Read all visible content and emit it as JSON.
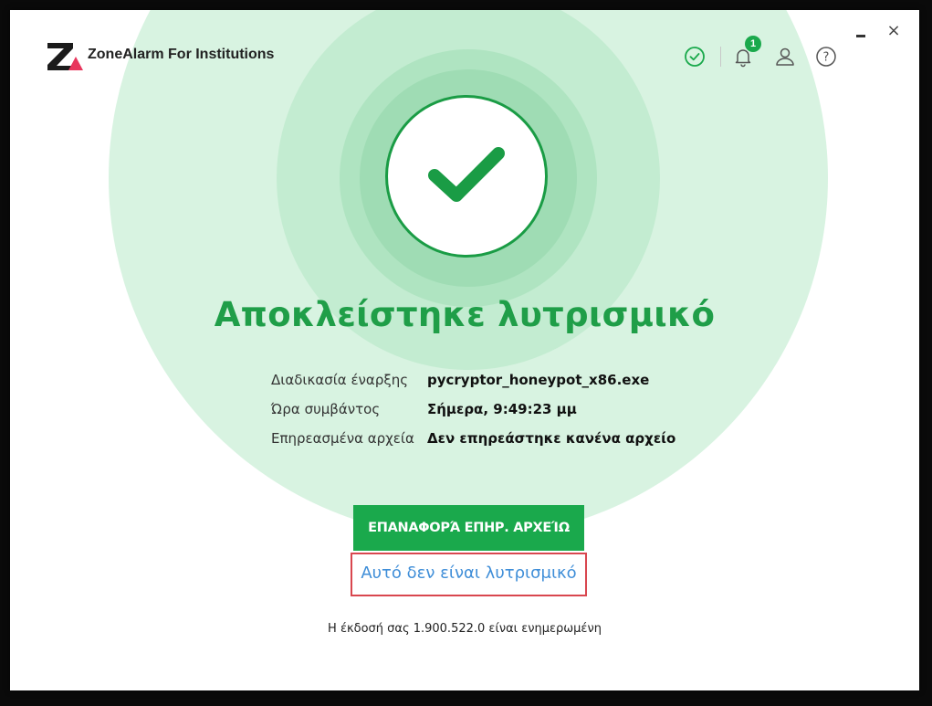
{
  "app": {
    "title": "ZoneAlarm For Institutions"
  },
  "header": {
    "notification_count": "1",
    "icons": [
      "status-ok-icon",
      "bell-icon",
      "user-icon",
      "help-icon"
    ],
    "help_symbol": "?",
    "close_symbol": "×"
  },
  "main": {
    "headline": "Αποκλείστηκε λυτρισμικό",
    "details": [
      {
        "label": "Διαδικασία έναρξης",
        "value": "pycryptor_honeypot_x86.exe"
      },
      {
        "label": "Ώρα συμβάντος",
        "value": "Σήμερα, 9:49:23 μμ"
      },
      {
        "label": "Επηρεασμένα αρχεία",
        "value": "Δεν επηρεάστηκε κανένα αρχείο"
      }
    ],
    "restore_button": "ΕΠΑΝΑΦΟΡΆ ΕΠΗΡ. ΑΡΧΕΊΩ",
    "not_ransomware_link": "Αυτό δεν είναι λυτρισμικό"
  },
  "footer": {
    "version_text": "Η έκδοσή σας 1.900.522.0 είναι ενημερωμένη"
  },
  "colors": {
    "accent_green": "#1aa94c",
    "headline_green": "#1f9e48",
    "link_blue": "#3f8ed8",
    "highlight_red": "#d9474f"
  }
}
